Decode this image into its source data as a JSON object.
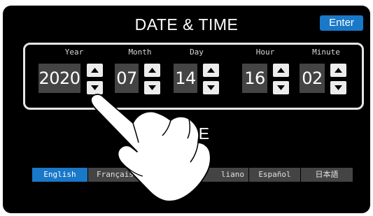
{
  "title": "DATE & TIME",
  "enter_label": "Enter",
  "fields": [
    {
      "label": "Year",
      "value": "2020"
    },
    {
      "label": "Month",
      "value": "07"
    },
    {
      "label": "Day",
      "value": "14"
    },
    {
      "label": "Hour",
      "value": "16"
    },
    {
      "label": "Minute",
      "value": "02"
    }
  ],
  "language": {
    "title_visible": "UAGE",
    "options": [
      {
        "label": "English",
        "selected": true
      },
      {
        "label": "Français",
        "selected": false
      },
      {
        "label": "",
        "selected": false
      },
      {
        "label": "liano",
        "selected": false
      },
      {
        "label": "Español",
        "selected": false
      },
      {
        "label": "日本語",
        "selected": false
      }
    ]
  },
  "icons": [
    "arrow-up-icon",
    "arrow-down-icon",
    "pointing-hand-icon"
  ],
  "colors": {
    "accent": "#1a78c8",
    "background": "#000000",
    "value_box": "#444444",
    "border": "#e6e6e6"
  }
}
